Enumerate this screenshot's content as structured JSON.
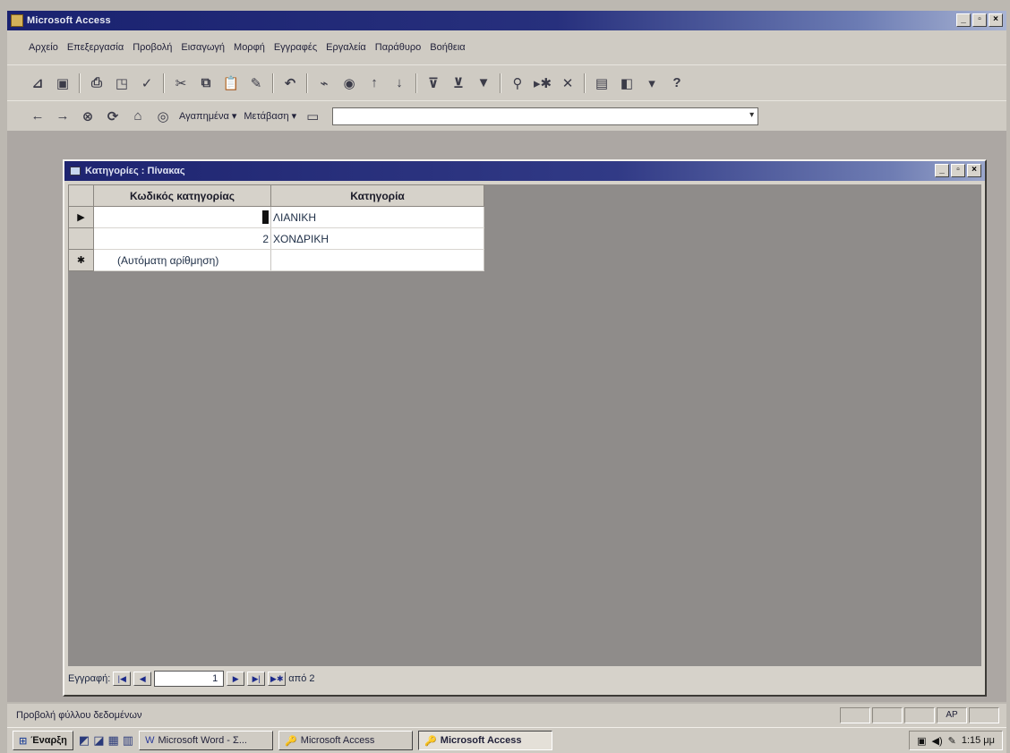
{
  "app": {
    "title": "Microsoft Access"
  },
  "menu": {
    "items": [
      "Αρχείο",
      "Επεξεργασία",
      "Προβολή",
      "Εισαγωγή",
      "Μορφή",
      "Εγγραφές",
      "Εργαλεία",
      "Παράθυρο",
      "Βοήθεια"
    ]
  },
  "web_toolbar": {
    "favorites_label": "Αγαπημένα ▾",
    "go_label": "Μετάβαση ▾",
    "address_value": ""
  },
  "table_window": {
    "title": "Κατηγορίες : Πίνακας",
    "columns": [
      "Κωδικός κατηγορίας",
      "Κατηγορία"
    ],
    "rows": [
      {
        "selector": "▶",
        "id": "1",
        "category": "ΛΙΑΝΙΚΗ"
      },
      {
        "selector": "",
        "id": "2",
        "category": "ΧΟΝΔΡΙΚΗ"
      }
    ],
    "new_row": {
      "selector": "✱",
      "id": "(Αυτόματη αρίθμηση)",
      "category": ""
    }
  },
  "navigation": {
    "label": "Εγγραφή:",
    "current": "1",
    "total_text": "από 2"
  },
  "status": {
    "text": "Προβολή φύλλου δεδομένων",
    "num_lock": "ΑΡ"
  },
  "taskbar": {
    "start_label": "Έναρξη",
    "tasks": [
      {
        "label": "Microsoft Word - Σ..."
      },
      {
        "label": "Microsoft Access"
      },
      {
        "label": "Microsoft Access"
      }
    ],
    "clock": "1:15 μμ"
  }
}
